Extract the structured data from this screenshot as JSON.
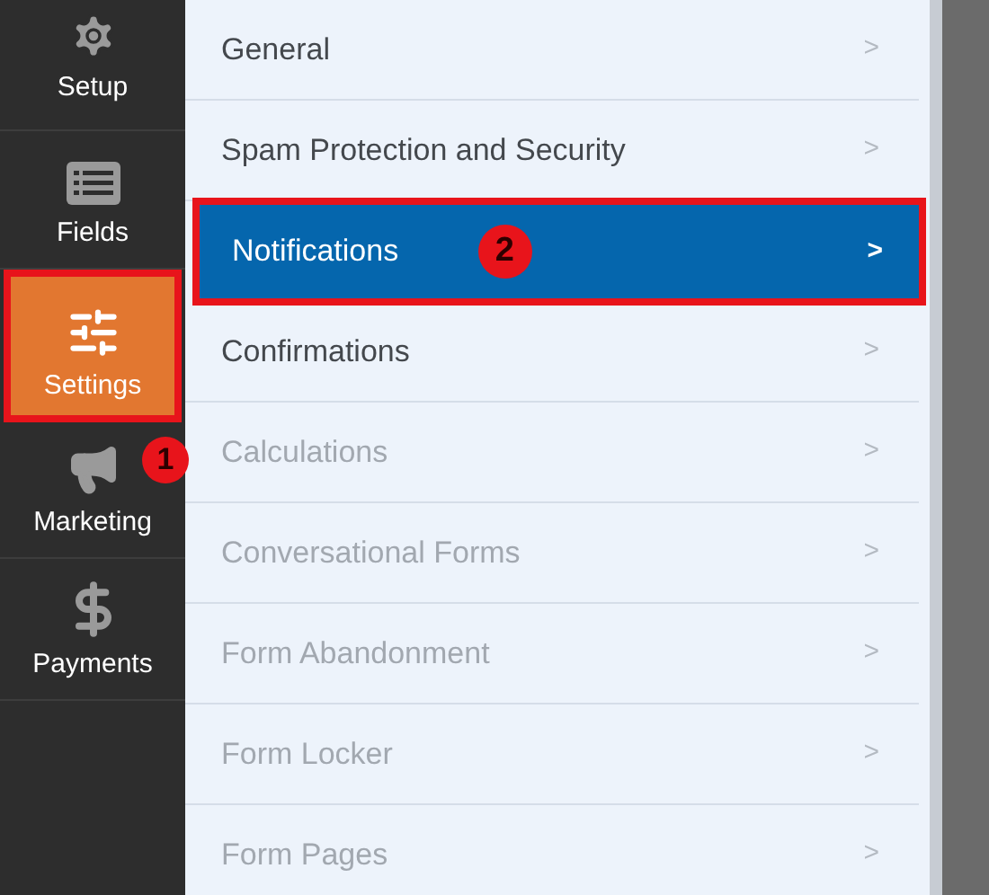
{
  "sidebar": {
    "items": [
      {
        "kind": "gear",
        "label": "Setup",
        "selected": false,
        "highlighted": false
      },
      {
        "kind": "list",
        "label": "Fields",
        "selected": false,
        "highlighted": false
      },
      {
        "kind": "sliders",
        "label": "Settings",
        "selected": true,
        "highlighted": true
      },
      {
        "kind": "megaphone",
        "label": "Marketing",
        "selected": false,
        "highlighted": false,
        "callout": "1"
      },
      {
        "kind": "dollar",
        "label": "Payments",
        "selected": false,
        "highlighted": false
      }
    ]
  },
  "menu": {
    "items": [
      {
        "label": "General",
        "chevron": ">",
        "selected": false,
        "disabled": false,
        "highlighted": false
      },
      {
        "label": "Spam Protection and Security",
        "chevron": ">",
        "selected": false,
        "disabled": false,
        "highlighted": false
      },
      {
        "label": "Notifications",
        "chevron": ">",
        "selected": true,
        "disabled": false,
        "highlighted": true,
        "callout": "2"
      },
      {
        "label": "Confirmations",
        "chevron": ">",
        "selected": false,
        "disabled": false,
        "highlighted": false
      },
      {
        "label": "Calculations",
        "chevron": ">",
        "selected": false,
        "disabled": true,
        "highlighted": false
      },
      {
        "label": "Conversational Forms",
        "chevron": ">",
        "selected": false,
        "disabled": true,
        "highlighted": false
      },
      {
        "label": "Form Abandonment",
        "chevron": ">",
        "selected": false,
        "disabled": true,
        "highlighted": false
      },
      {
        "label": "Form Locker",
        "chevron": ">",
        "selected": false,
        "disabled": true,
        "highlighted": false
      },
      {
        "label": "Form Pages",
        "chevron": ">",
        "selected": false,
        "disabled": true,
        "highlighted": false
      }
    ]
  }
}
